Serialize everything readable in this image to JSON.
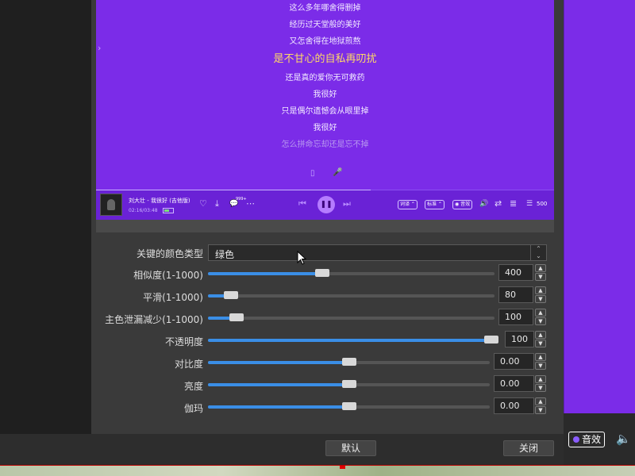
{
  "player": {
    "lyrics": [
      {
        "text": "这么多年哪舍得删掉",
        "state": "normal"
      },
      {
        "text": "经历过天堂般的美好",
        "state": "normal"
      },
      {
        "text": "又怎舍得在地狱煎熬",
        "state": "normal"
      },
      {
        "text": "是不甘心的自私再叨扰",
        "state": "active"
      },
      {
        "text": "还是真的爱你无可救药",
        "state": "normal"
      },
      {
        "text": "我很好",
        "state": "normal"
      },
      {
        "text": "只是偶尔遗憾会从眼里掉",
        "state": "normal"
      },
      {
        "text": "我很好",
        "state": "normal"
      },
      {
        "text": "怎么拼命忘却还是忘不掉",
        "state": "dim"
      }
    ],
    "side_arrow": "›",
    "song_title": "刘大壮 - 我很好 (吉他版)",
    "song_time": "02:16/03:48",
    "progress": 0.6,
    "comment_count": "999+",
    "buttons": {
      "like": "♡",
      "download": "⤓",
      "comment": "💬",
      "more": "⋯",
      "prev": "⏮",
      "play_pause": "❚❚",
      "next": "⏭",
      "lyrics_mode": "词译 ⌃",
      "quality": "标准 ⌃",
      "effect": "◉ 音效",
      "volume": "🔊",
      "repeat": "⇄",
      "playlist": "≣",
      "count": "500"
    },
    "tools": {
      "left": "▯",
      "right": "🎤"
    },
    "accent": "#7b2ce8"
  },
  "filters": {
    "color_type": {
      "label": "关键的颜色类型",
      "value": "绿色"
    },
    "similarity": {
      "label": "相似度(1-1000)",
      "value": "400",
      "level": 0.4
    },
    "smooth": {
      "label": "平滑(1-1000)",
      "value": "80",
      "level": 0.08
    },
    "spill": {
      "label": "主色泄漏减少(1-1000)",
      "value": "100",
      "level": 0.1
    },
    "opacity": {
      "label": "不透明度",
      "value": "100",
      "level": 1.0
    },
    "contrast": {
      "label": "对比度",
      "value": "0.00",
      "level": 0.5
    },
    "brightness": {
      "label": "亮度",
      "value": "0.00",
      "level": 0.5
    },
    "gamma": {
      "label": "伽玛",
      "value": "0.00",
      "level": 0.5
    }
  },
  "dialog_buttons": {
    "defaults": "默认",
    "close": "关闭"
  },
  "right_strip": {
    "effect_label": "音效"
  },
  "slider_color": "#3a8ee6"
}
